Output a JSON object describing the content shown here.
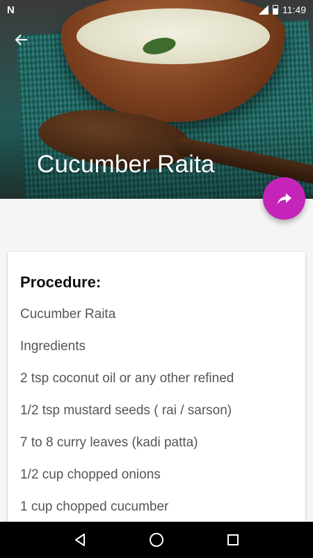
{
  "status_bar": {
    "left_icon": "n-notification-icon",
    "time": "11:49"
  },
  "header": {
    "title": "Cucumber Raita",
    "back_icon": "arrow-left-icon"
  },
  "fab": {
    "icon": "share-icon",
    "color": "#c425b8"
  },
  "card": {
    "heading": "Procedure:",
    "lines": [
      "Cucumber Raita",
      "Ingredients",
      "2 tsp coconut oil or any other refined",
      "1/2 tsp mustard seeds ( rai / sarson)",
      "7 to 8 curry leaves (kadi patta)",
      "1/2 cup chopped onions",
      "1 cup chopped cucumber"
    ]
  },
  "nav_bar": {
    "back_icon": "triangle-back-icon",
    "home_icon": "circle-home-icon",
    "recents_icon": "square-recents-icon"
  }
}
